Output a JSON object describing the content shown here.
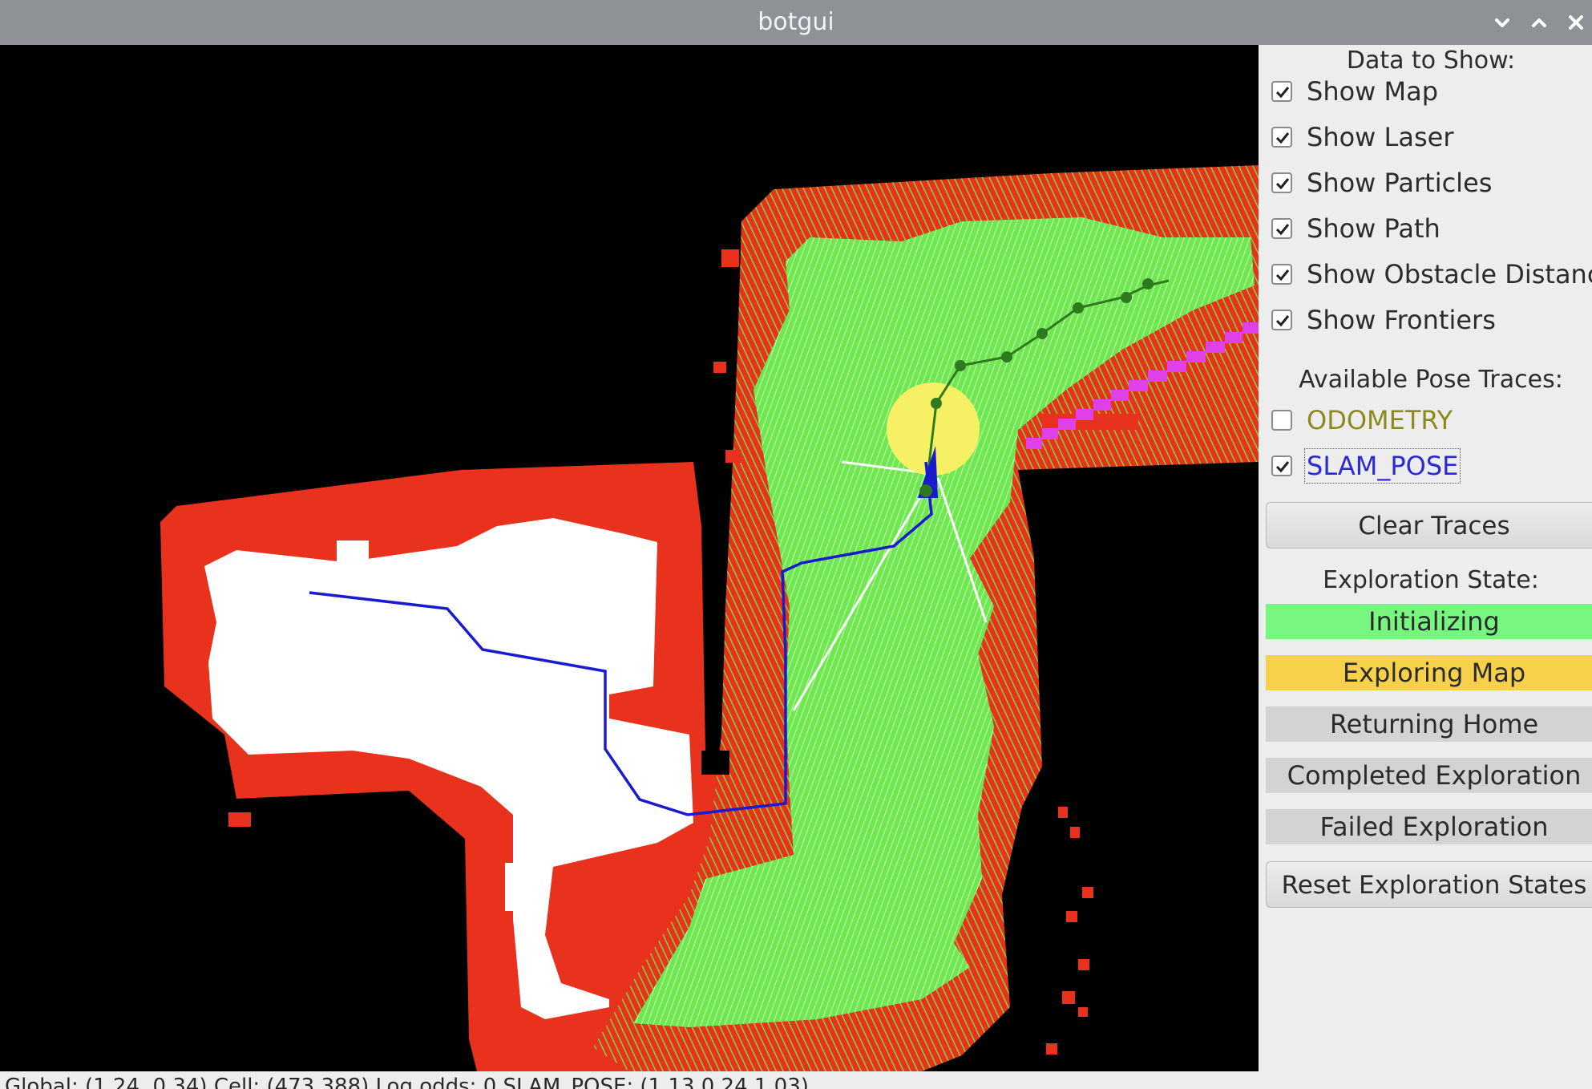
{
  "window": {
    "title": "botgui"
  },
  "panel": {
    "data_header": "Data to Show:",
    "data_options": [
      {
        "label": "Show Map",
        "checked": true
      },
      {
        "label": "Show Laser",
        "checked": true
      },
      {
        "label": "Show Particles",
        "checked": true
      },
      {
        "label": "Show Path",
        "checked": true
      },
      {
        "label": "Show Obstacle Distances",
        "checked": true
      },
      {
        "label": "Show Frontiers",
        "checked": true
      }
    ],
    "traces_header": "Available Pose Traces:",
    "traces": [
      {
        "label": "ODOMETRY",
        "checked": false,
        "color": "#8c8a1e"
      },
      {
        "label": "SLAM_POSE",
        "checked": true,
        "color": "#2a2ad6"
      }
    ],
    "clear_label": "Clear Traces",
    "exploration_header": "Exploration State:",
    "states": [
      {
        "label": "Initializing",
        "color": "#77f77f"
      },
      {
        "label": "Exploring Map",
        "color": "#f7d14a"
      },
      {
        "label": "Returning Home",
        "color": "#d3d3d3"
      },
      {
        "label": "Completed Exploration",
        "color": "#d3d3d3"
      },
      {
        "label": "Failed Exploration",
        "color": "#d3d3d3"
      }
    ],
    "reset_label": "Reset Exploration States"
  },
  "status": {
    "text": "Global: (1.24, 0.34) Cell: (473,388) Log odds: 0    SLAM_POSE: (1.13,0.24,1.03)"
  },
  "colors": {
    "free": "#ffffff",
    "obstacle": "#e8321e",
    "laser": "#7cfc5a",
    "path": "#1a1acf",
    "frontier": "#e040e8",
    "robot_zone": "#f5f064",
    "planned_path": "#2f7a1e"
  },
  "icons": {
    "minimize": "chevron-down-icon",
    "maximize": "chevron-up-icon",
    "close": "close-icon",
    "check": "check-icon"
  }
}
